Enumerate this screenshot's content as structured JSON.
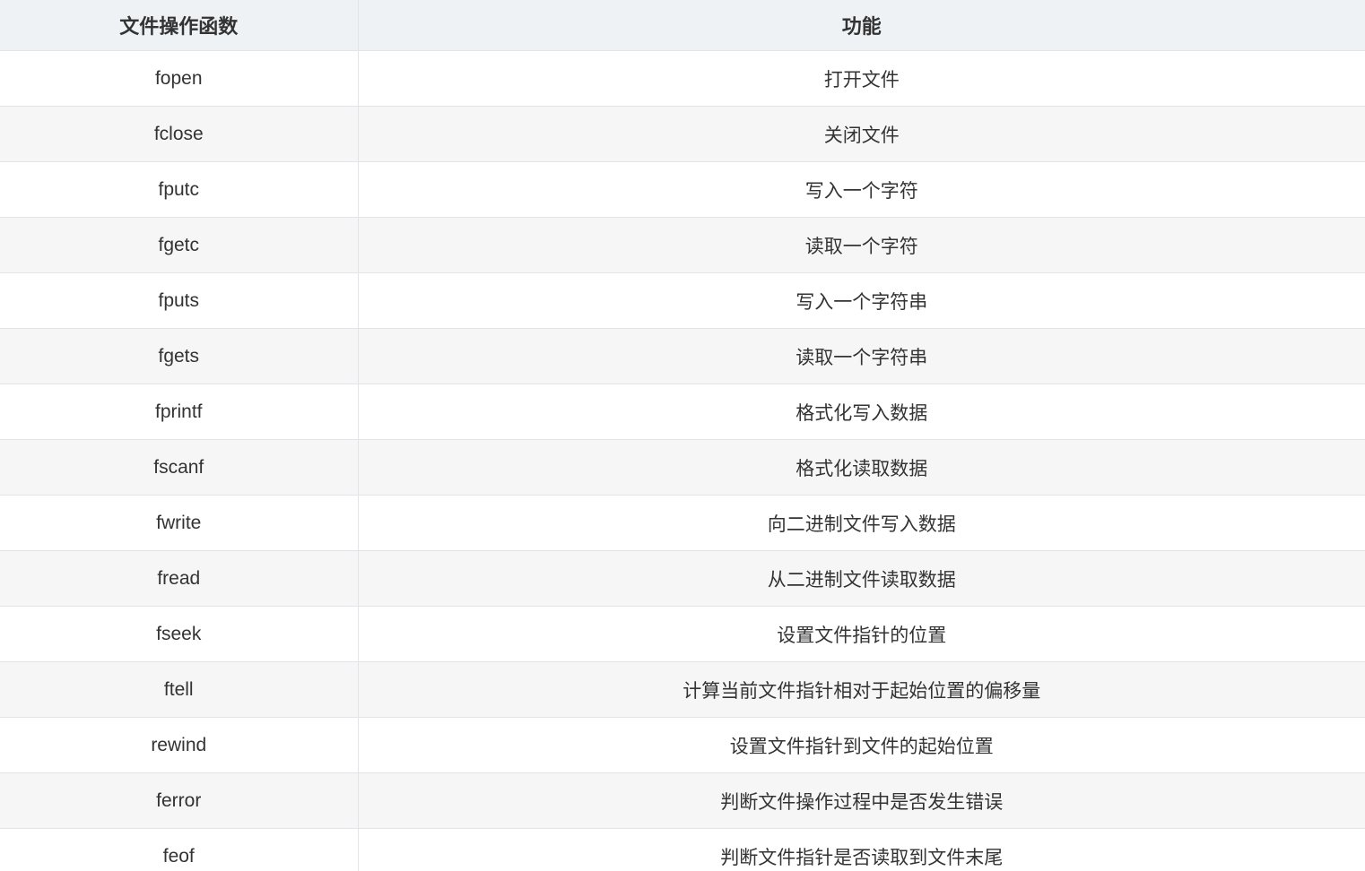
{
  "table": {
    "headers": [
      "文件操作函数",
      "功能"
    ],
    "rows": [
      [
        "fopen",
        "打开文件"
      ],
      [
        "fclose",
        "关闭文件"
      ],
      [
        "fputc",
        "写入一个字符"
      ],
      [
        "fgetc",
        "读取一个字符"
      ],
      [
        "fputs",
        "写入一个字符串"
      ],
      [
        "fgets",
        "读取一个字符串"
      ],
      [
        "fprintf",
        "格式化写入数据"
      ],
      [
        "fscanf",
        "格式化读取数据"
      ],
      [
        "fwrite",
        "向二进制文件写入数据"
      ],
      [
        "fread",
        "从二进制文件读取数据"
      ],
      [
        "fseek",
        "设置文件指针的位置"
      ],
      [
        "ftell",
        "计算当前文件指针相对于起始位置的偏移量"
      ],
      [
        "rewind",
        "设置文件指针到文件的起始位置"
      ],
      [
        "ferror",
        "判断文件操作过程中是否发生错误"
      ],
      [
        "feof",
        "判断文件指针是否读取到文件末尾"
      ]
    ]
  }
}
